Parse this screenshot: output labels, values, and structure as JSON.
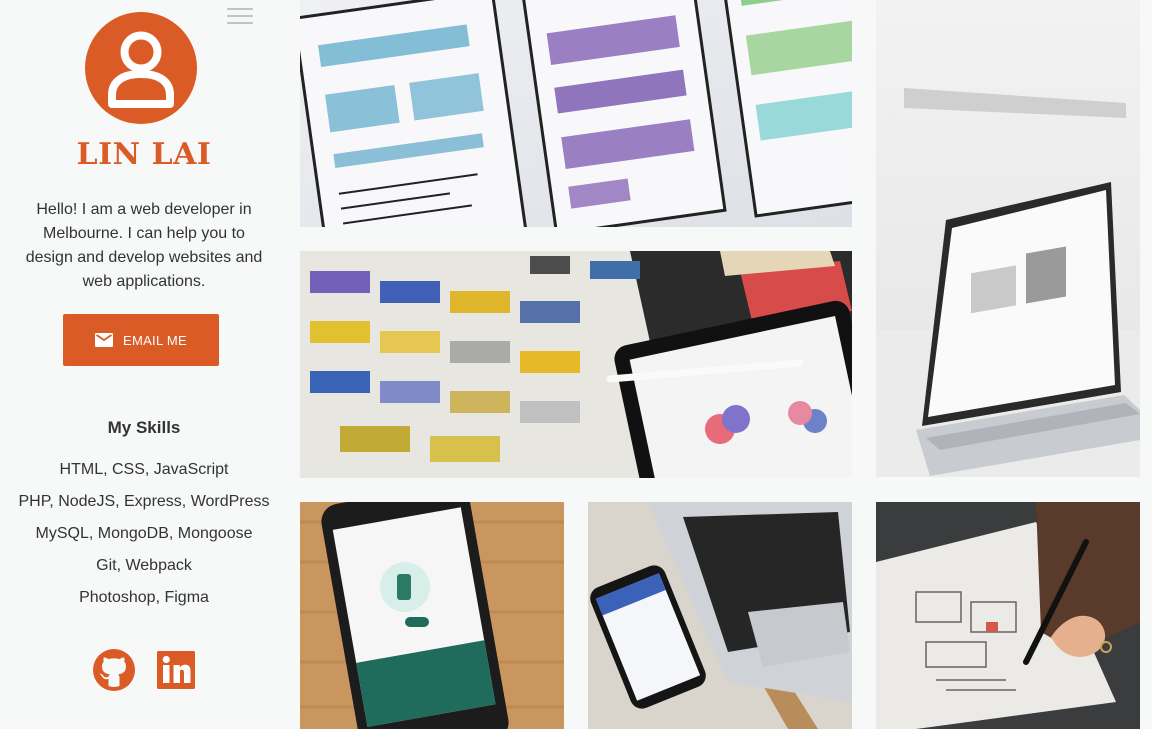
{
  "profile": {
    "name": "LIN LAI",
    "bio": "Hello! I am a web developer in Melbourne. I can help you to design and develop websites and web applications.",
    "email_button_label": "EMAIL ME"
  },
  "skills": {
    "title": "My Skills",
    "items": [
      "HTML, CSS, JavaScript",
      "PHP, NodeJS, Express, WordPress",
      "MySQL, MongoDB, Mongoose",
      "Git, Webpack",
      "Photoshop, Figma"
    ]
  },
  "social": [
    {
      "icon": "github-icon"
    },
    {
      "icon": "linkedin-icon"
    }
  ],
  "gallery": [
    {
      "name": "wireframe-sketch-photo"
    },
    {
      "name": "laptop-photo"
    },
    {
      "name": "color-swatches-tablet-photo"
    },
    {
      "name": "phone-app-photo"
    },
    {
      "name": "phone-laptop-photo"
    },
    {
      "name": "hand-drawing-wireframe-photo"
    }
  ],
  "colors": {
    "accent": "#db5b27",
    "background": "#f7f8f8",
    "text": "#333333"
  }
}
